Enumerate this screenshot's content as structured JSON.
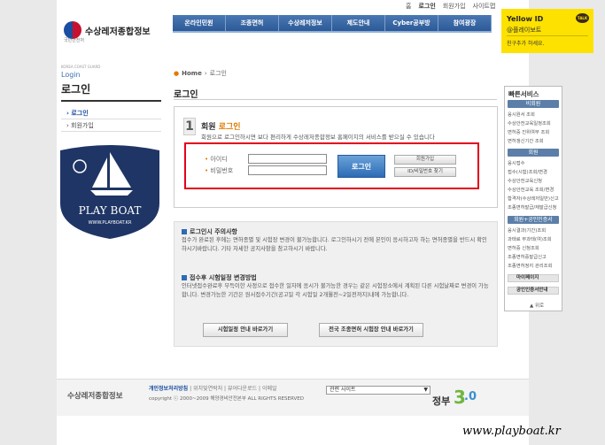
{
  "top_links": [
    "홈",
    "로그인",
    "회원가입",
    "사이트맵"
  ],
  "logo": {
    "text": "수상레저종합정보",
    "sub": "국민안전처"
  },
  "gnb": [
    "온라인민원",
    "조종면허",
    "수상레저정보",
    "제도안내",
    "Cyber공부방",
    "참여광장"
  ],
  "lnb": {
    "small": "KOREA COAST GUARD",
    "en": "Login",
    "title": "로그인",
    "items": [
      "로그인",
      "회원가입"
    ]
  },
  "badge": {
    "text": "PLAY BOAT",
    "url": "WWW.PLAYBOAT.KR"
  },
  "breadcrumb": {
    "home": "Home",
    "current": "로그인"
  },
  "page_title": "로그인",
  "login": {
    "num": "1",
    "title_a": "회원",
    "title_b": "로그인",
    "desc": "회원으로 로그인하시면 보다 편리하게 수상레저종합정보 홈페이지의 서비스를 받으실 수 있습니다",
    "id_label": "아이디",
    "pw_label": "비밀번호",
    "id_value": "",
    "pw_value": "",
    "login_button": "로그인",
    "join_button": "회원가입",
    "find_button": "ID/비밀번호 찾기"
  },
  "notice": {
    "head1": "로그인시 주의사항",
    "text1": "접수가 완료된 후에는 면허종별 및 시험장 변경이 불가능합니다. 로그인하시기 전에 본인이 응시하고자 하는 면허종별을 반드시 확인하시기바랍니다. 기타 자세한 공지사항을 참고하시기 바랍니다.",
    "head2": "접수후 시험일정 변경방법",
    "text2": "인터넷접수완료후 부득이한 사정으로 접수한 일자에 응시가 불가능한 경우는 같은 시험장소에서 계획된 다른 시험날짜로 변경이 가능합니다. 변경가능한 기간은 원서접수기간(공고일 각 시험일 2개월전~2일전까지)내에 가능합니다.",
    "btn1": "시험일정 안내 바로가기",
    "btn2": "전국 조종면허 시험장 안내 바로가기"
  },
  "footer": {
    "logo": "수상레저종합정보",
    "links": [
      "개인정보처리방침",
      "위치및연락처",
      "뷰어다운로드",
      "이메일"
    ],
    "copy": "copyright ⓒ 2000~2009 해양경비안전본부 ALL RIGHTS RESERVED",
    "select": "관련 사이트",
    "gov_a": "정부",
    "gov_b": "3",
    "gov_c": ".0"
  },
  "yellow": {
    "title": "Yellow ID",
    "sub": "@플레이보트",
    "desc": "친구추가 하세요.",
    "talk": "TALK"
  },
  "quick": {
    "title": "빠른서비스",
    "sec1": "비회원",
    "items1": [
      "응시원서 조회",
      "수상안전교육일정조회",
      "면허증 진위여부 조회",
      "면허갱신기간 조회"
    ],
    "sec2": "회원",
    "items2": [
      "응시접수",
      "접수(시험)조회/변경",
      "수상안전교육신청",
      "수상안전교육 조회/변경",
      "합격자(수상레저일반)신고",
      "조종면허발급/재발급신청"
    ],
    "sec3": "회원+공인인증서",
    "items3": [
      "응시결과(기간)조회",
      "과태료 무과태(여)조회",
      "면허증 신청조회",
      "조종면허증발급신고",
      "조종면허정지 관리조회"
    ],
    "bar1": "마이페이지",
    "bar2": "공인인증서안내",
    "top": "위로"
  },
  "watermark": "www.playboat.kr"
}
